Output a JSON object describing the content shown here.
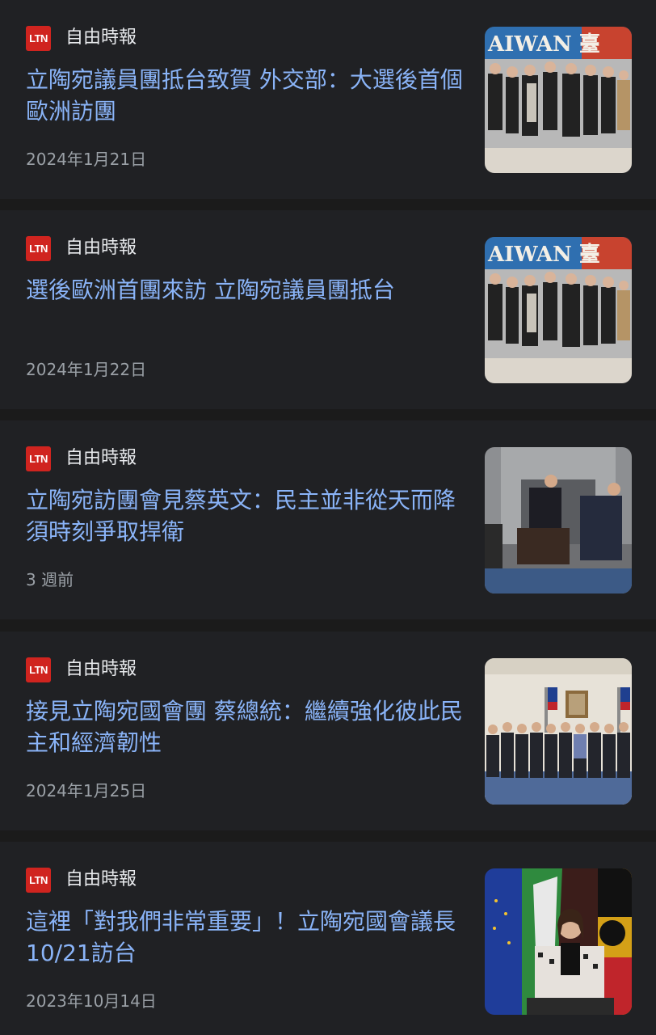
{
  "articles": [
    {
      "logo_text": "LTN",
      "source": "自由時報",
      "headline": "立陶宛議員團抵台致賀 外交部：大選後首個歐洲訪團",
      "date": "2024年1月21日",
      "thumbnail_banner": "AIWAN 臺"
    },
    {
      "logo_text": "LTN",
      "source": "自由時報",
      "headline": "選後歐洲首團來訪 立陶宛議員團抵台",
      "date": "2024年1月22日",
      "thumbnail_banner": "AIWAN 臺"
    },
    {
      "logo_text": "LTN",
      "source": "自由時報",
      "headline": "立陶宛訪團會見蔡英文：民主並非從天而降 須時刻爭取捍衛",
      "date": "3 週前"
    },
    {
      "logo_text": "LTN",
      "source": "自由時報",
      "headline": "接見立陶宛國會團 蔡總統：繼續強化彼此民主和經濟韌性",
      "date": "2024年1月25日"
    },
    {
      "logo_text": "LTN",
      "source": "自由時報",
      "headline": "這裡「對我們非常重要」！立陶宛國會議長10/21訪台",
      "date": "2023年10月14日"
    }
  ],
  "colors": {
    "background": "#1b1b1b",
    "card": "#202124",
    "headline": "#8ab4f8",
    "source_text": "#e8eaed",
    "date_text": "#9aa0a6",
    "logo_red": "#d0241f"
  }
}
